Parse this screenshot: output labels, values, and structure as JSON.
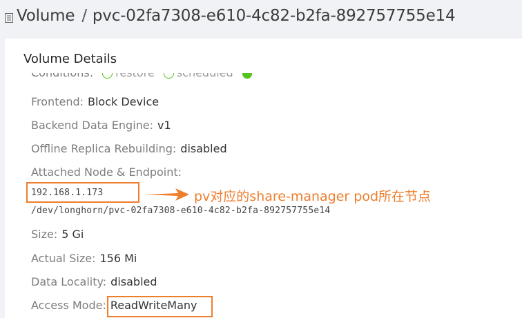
{
  "header": {
    "section": "Volume",
    "separator": "/",
    "volume_name": "pvc-02fa7308-e610-4c82-b2fa-892757755e14"
  },
  "card": {
    "title": "Volume Details",
    "conditions": {
      "label": "Conditions:",
      "items": [
        "restore",
        "scheduled"
      ]
    },
    "frontend": {
      "label": "Frontend:",
      "value": "Block Device"
    },
    "backend_engine": {
      "label": "Backend Data Engine:",
      "value": "v1"
    },
    "offline_rebuilding": {
      "label": "Offline Replica Rebuilding:",
      "value": "disabled"
    },
    "attached": {
      "label": "Attached Node & Endpoint:",
      "node_ip": "192.168.1.173",
      "endpoint": "/dev/longhorn/pvc-02fa7308-e610-4c82-b2fa-892757755e14"
    },
    "size": {
      "label": "Size:",
      "value": "5 Gi"
    },
    "actual_size": {
      "label": "Actual Size:",
      "value": "156 Mi"
    },
    "data_locality": {
      "label": "Data Locality:",
      "value": "disabled"
    },
    "access_mode": {
      "label": "Access Mode:",
      "value": "ReadWriteMany"
    }
  },
  "annotation": {
    "text": "pv对应的share-manager pod所在节点",
    "color": "#ee7d2c"
  },
  "colors": {
    "success": "#52c41a",
    "label": "#7d7d7d",
    "value": "#333333"
  }
}
